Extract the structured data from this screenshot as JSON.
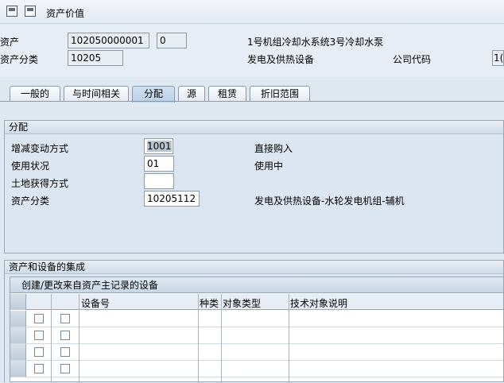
{
  "titlebar": {
    "title": "资产价值",
    "icons": [
      "save-document-icon",
      "refresh-document-icon"
    ]
  },
  "header": {
    "asset_label": "资产",
    "asset_number": "102050000001",
    "asset_sub": "0",
    "asset_desc": "1号机组冷却水系统3号冷却水泵",
    "class_label": "资产分类",
    "class_value": "10205",
    "class_desc": "发电及供热设备",
    "company_label": "公司代码",
    "company_value": "1("
  },
  "tabs": [
    {
      "label": "一般的",
      "active": false
    },
    {
      "label": "与时间相关",
      "active": false
    },
    {
      "label": "分配",
      "active": true
    },
    {
      "label": "源",
      "active": false
    },
    {
      "label": "租赁",
      "active": false
    },
    {
      "label": "折旧范围",
      "active": false
    }
  ],
  "assignment": {
    "title": "分配",
    "rows": [
      {
        "label": "增减变动方式",
        "value": "1001",
        "desc": "直接购入"
      },
      {
        "label": "使用状况",
        "value": "01",
        "desc": "使用中"
      },
      {
        "label": "土地获得方式",
        "value": "",
        "desc": ""
      },
      {
        "label": "资产分类",
        "value": "10205112",
        "desc": "发电及供热设备-水轮发电机组-辅机"
      }
    ]
  },
  "integration": {
    "title": "资产和设备的集成",
    "subtitle": "创建/更改来自资产主记录的设备",
    "columns": [
      "设备号",
      "种类",
      "对象类型",
      "技术对象说明"
    ],
    "row_count": 4
  }
}
